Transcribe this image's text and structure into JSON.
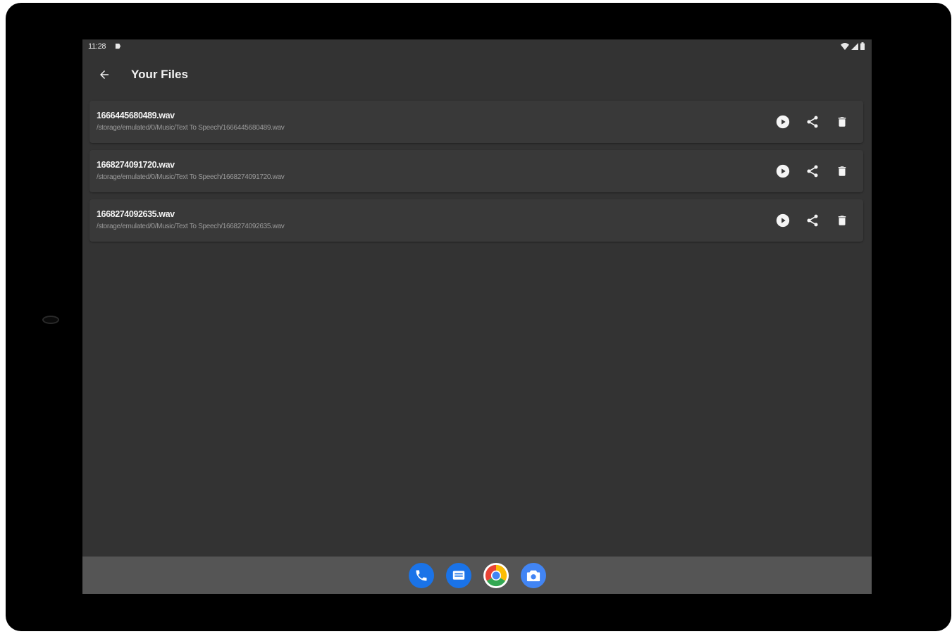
{
  "status_bar": {
    "time": "11:28"
  },
  "app_bar": {
    "title": "Your Files",
    "back_icon": "arrow-back-icon"
  },
  "files": [
    {
      "name": "1666445680489.wav",
      "path": "/storage/emulated/0/Music/Text To Speech/1666445680489.wav"
    },
    {
      "name": "1668274091720.wav",
      "path": "/storage/emulated/0/Music/Text To Speech/1668274091720.wav"
    },
    {
      "name": "1668274092635.wav",
      "path": "/storage/emulated/0/Music/Text To Speech/1668274092635.wav"
    }
  ],
  "row_action_icons": [
    "play-icon",
    "share-icon",
    "delete-icon"
  ],
  "dock": {
    "apps": [
      "phone-app-icon",
      "messages-app-icon",
      "chrome-app-icon",
      "camera-app-icon"
    ]
  },
  "colors": {
    "screen_background": "#333333",
    "row_background": "#393939",
    "dock_background": "#555555",
    "accent_blue": "#1a73e8"
  }
}
